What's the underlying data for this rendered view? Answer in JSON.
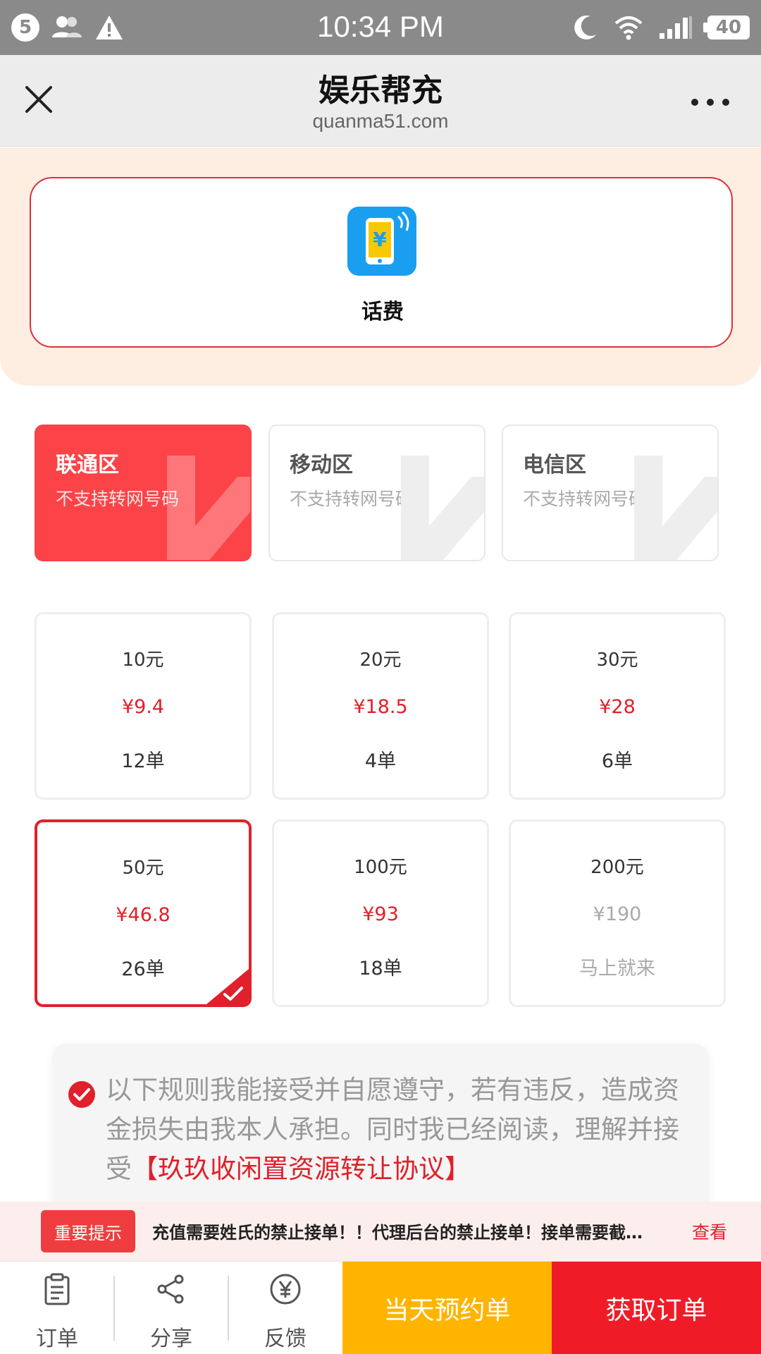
{
  "status_bar": {
    "notification_count": "5",
    "time": "10:34 PM",
    "battery": "40",
    "icons": [
      "notification-count-icon",
      "contacts-icon",
      "warning-icon",
      "moon-icon",
      "wifi-icon",
      "signal-icon",
      "battery-icon"
    ]
  },
  "header": {
    "title": "娱乐帮充",
    "subtitle": "quanma51.com",
    "icons": [
      "close-icon",
      "more-icon"
    ]
  },
  "category": {
    "label": "话费",
    "icon": "phone-bill-icon",
    "accent": "#e0303a",
    "background": "#fdeee1"
  },
  "zones": [
    {
      "title": "联通区",
      "subtitle": "不支持转网号码",
      "active": true
    },
    {
      "title": "移动区",
      "subtitle": "不支持转网号码",
      "active": false
    },
    {
      "title": "电信区",
      "subtitle": "不支持转网号码",
      "active": false
    }
  ],
  "products": [
    {
      "face": "10元",
      "price": "¥9.4",
      "count": "12单",
      "selected": false,
      "disabled": false
    },
    {
      "face": "20元",
      "price": "¥18.5",
      "count": "4单",
      "selected": false,
      "disabled": false
    },
    {
      "face": "30元",
      "price": "¥28",
      "count": "6单",
      "selected": false,
      "disabled": false
    },
    {
      "face": "50元",
      "price": "¥46.8",
      "count": "26单",
      "selected": true,
      "disabled": false
    },
    {
      "face": "100元",
      "price": "¥93",
      "count": "18单",
      "selected": false,
      "disabled": false
    },
    {
      "face": "200元",
      "price": "¥190",
      "count": "马上就来",
      "selected": false,
      "disabled": true
    }
  ],
  "rules": {
    "text": "以下规则我能接受并自愿遵守，若有违反，造成资金损失由我本人承担。同时我已经阅读，理解并接受",
    "link": "【玖玖收闲置资源转让协议】",
    "checked": true
  },
  "notice": {
    "badge": "重要提示",
    "text": "充值需要姓氏的禁止接单！！代理后台的禁止接单！接单需要截图！",
    "action": "查看"
  },
  "bottom_nav": {
    "items": [
      {
        "label": "订单",
        "icon": "clipboard-icon"
      },
      {
        "label": "分享",
        "icon": "share-icon"
      },
      {
        "label": "反馈",
        "icon": "yen-circle-icon"
      }
    ],
    "reserve_label": "当天预约单",
    "get_label": "获取订单",
    "colors": {
      "reserve": "#ffb400",
      "get": "#ef1c28"
    }
  }
}
